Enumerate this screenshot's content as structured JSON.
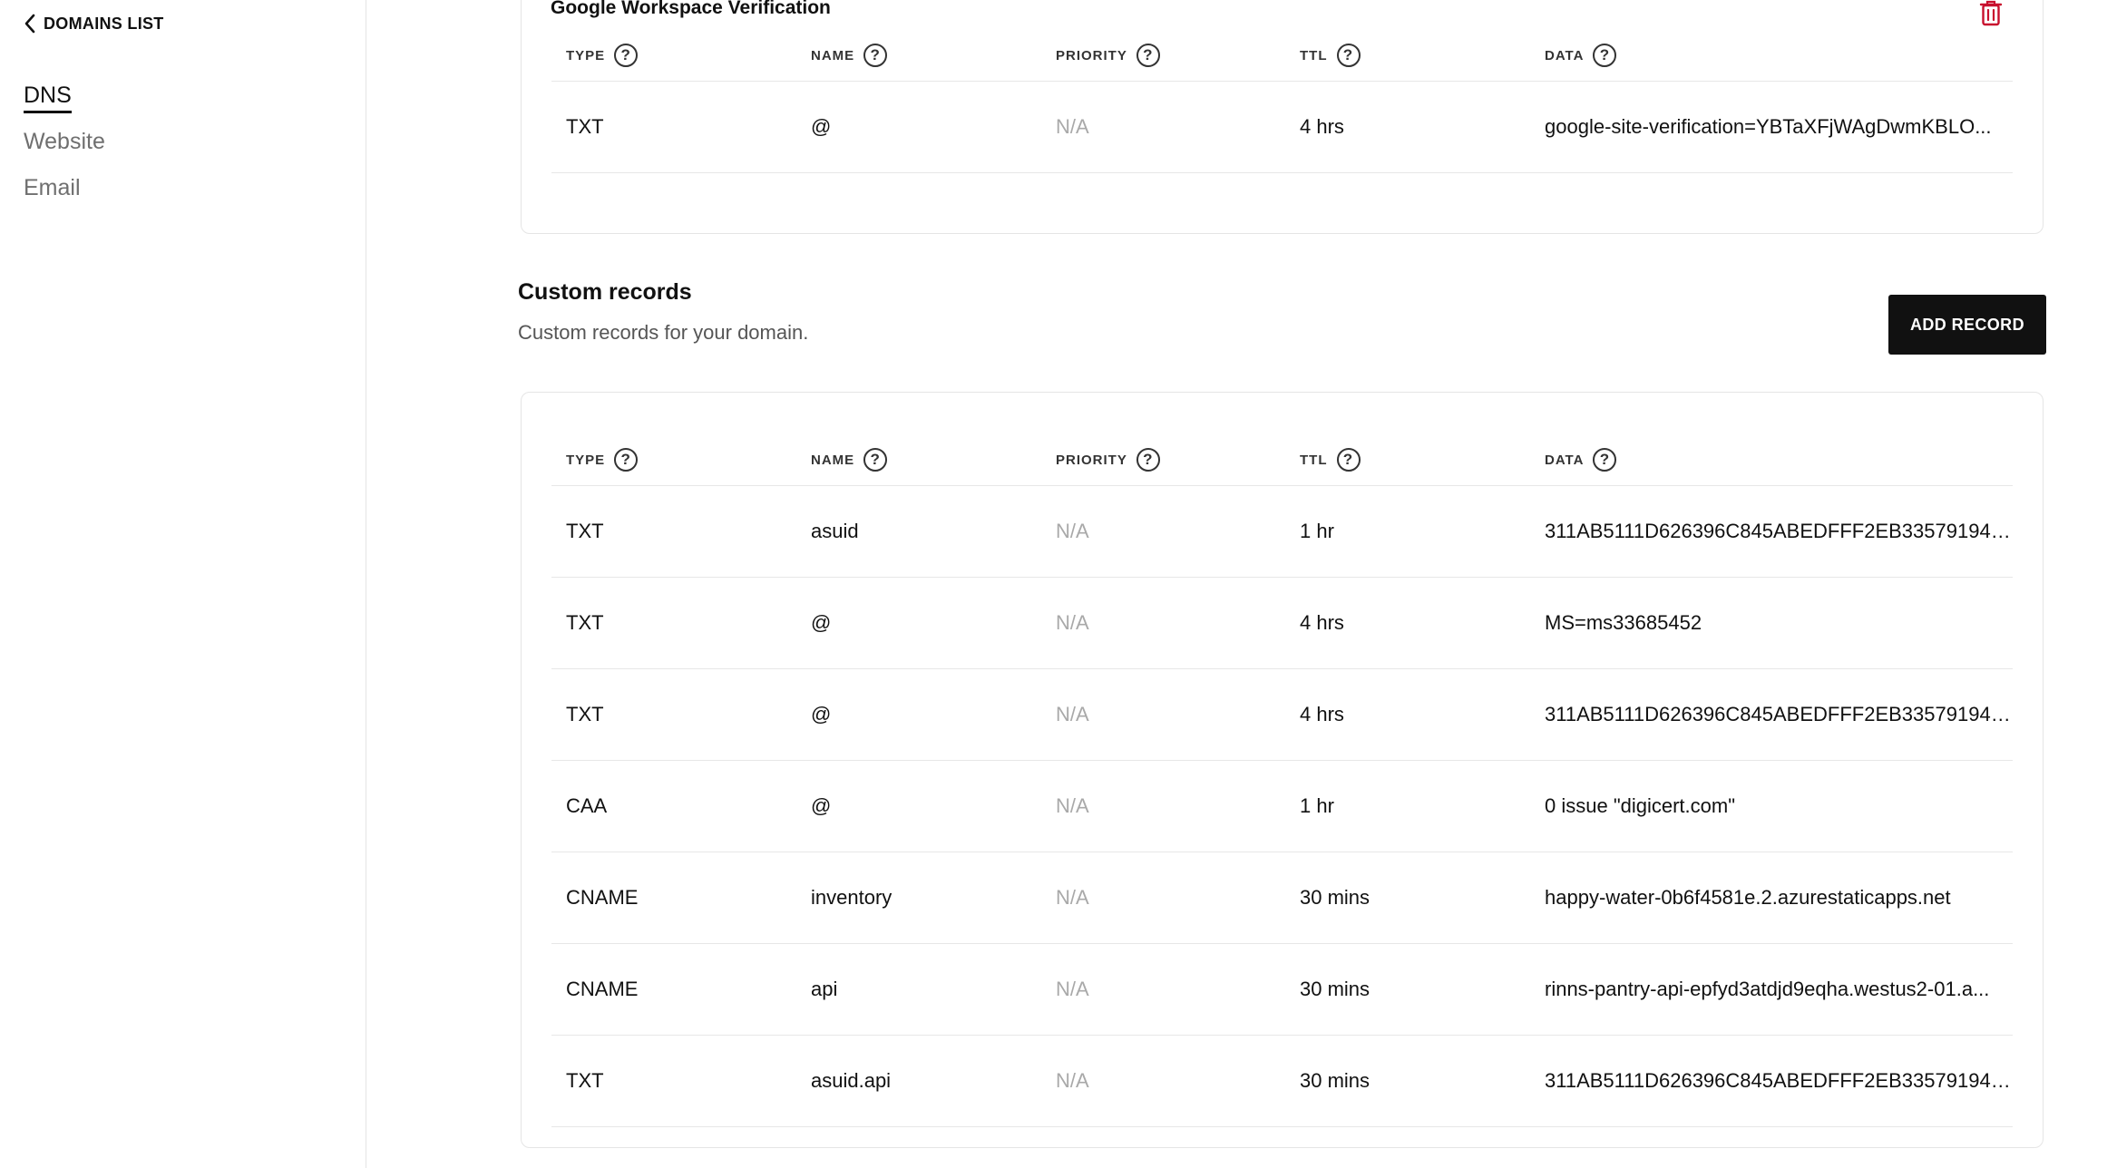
{
  "sidebar": {
    "back_label": "DOMAINS LIST",
    "nav": [
      {
        "label": "DNS",
        "active": true
      },
      {
        "label": "Website",
        "active": false
      },
      {
        "label": "Email",
        "active": false
      }
    ]
  },
  "columns": [
    "TYPE",
    "NAME",
    "PRIORITY",
    "TTL",
    "DATA"
  ],
  "help_glyph": "?",
  "workspace": {
    "title": "Google Workspace Verification",
    "rows": [
      {
        "type": "TXT",
        "name": "@",
        "priority": "N/A",
        "ttl": "4 hrs",
        "data": "google-site-verification=YBTaXFjWAgDwmKBLO..."
      }
    ]
  },
  "custom": {
    "title": "Custom records",
    "description": "Custom records for your domain.",
    "add_label": "ADD RECORD",
    "rows": [
      {
        "type": "TXT",
        "name": "asuid",
        "priority": "N/A",
        "ttl": "1 hr",
        "data": "311AB5111D626396C845ABEDFFF2EB33579194EA..."
      },
      {
        "type": "TXT",
        "name": "@",
        "priority": "N/A",
        "ttl": "4 hrs",
        "data": "MS=ms33685452"
      },
      {
        "type": "TXT",
        "name": "@",
        "priority": "N/A",
        "ttl": "4 hrs",
        "data": "311AB5111D626396C845ABEDFFF2EB33579194EA..."
      },
      {
        "type": "CAA",
        "name": "@",
        "priority": "N/A",
        "ttl": "1 hr",
        "data": "0 issue \"digicert.com\""
      },
      {
        "type": "CNAME",
        "name": "inventory",
        "priority": "N/A",
        "ttl": "30 mins",
        "data": "happy-water-0b6f4581e.2.azurestaticapps.net"
      },
      {
        "type": "CNAME",
        "name": "api",
        "priority": "N/A",
        "ttl": "30 mins",
        "data": "rinns-pantry-api-epfyd3atdjd9eqha.westus2-01.a..."
      },
      {
        "type": "TXT",
        "name": "asuid.api",
        "priority": "N/A",
        "ttl": "30 mins",
        "data": "311AB5111D626396C845ABEDFFF2EB33579194EA..."
      }
    ]
  },
  "colors": {
    "accent": "#111111",
    "muted": "#a9a9a9",
    "danger": "#c8102e"
  }
}
